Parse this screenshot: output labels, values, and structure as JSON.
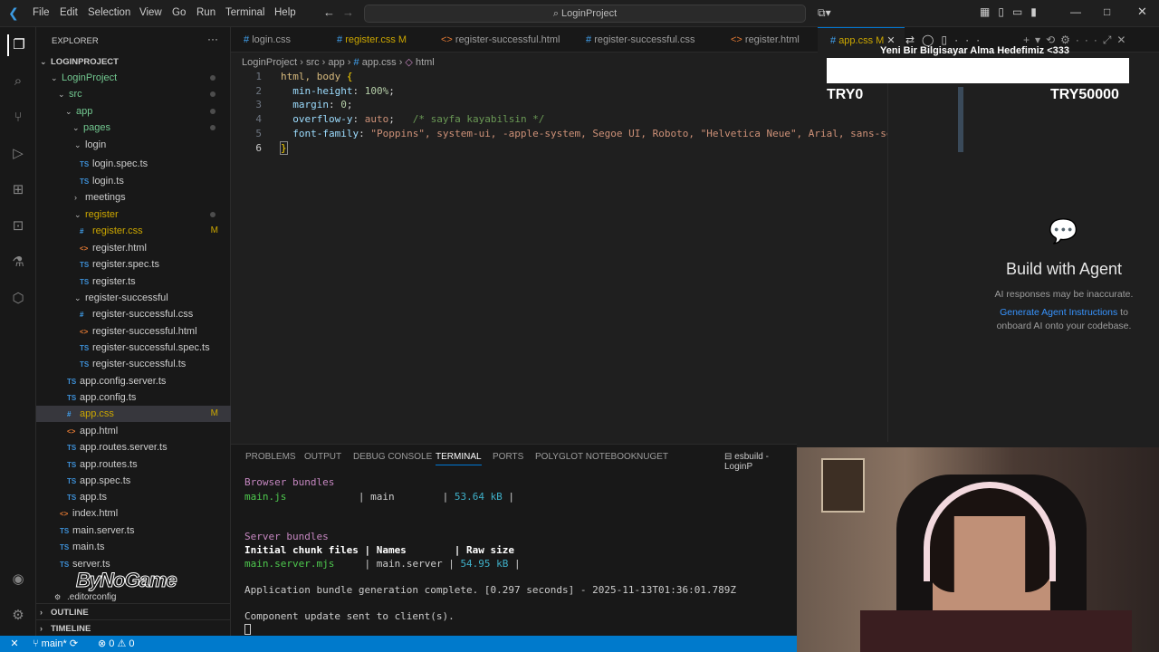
{
  "menu": [
    "File",
    "Edit",
    "Selection",
    "View",
    "Go",
    "Run",
    "Terminal",
    "Help"
  ],
  "command_center": "LoginProject",
  "sidebar": {
    "header": "EXPLORER",
    "root": "LOGINPROJECT",
    "tree": [
      {
        "label": "LoginProject",
        "type": "folder"
      },
      {
        "label": "src",
        "type": "folder"
      },
      {
        "label": "app",
        "type": "folder"
      },
      {
        "label": "pages",
        "type": "folder"
      },
      {
        "label": "login",
        "type": "folder"
      },
      {
        "label": "login.spec.ts",
        "type": "ts"
      },
      {
        "label": "login.ts",
        "type": "ts"
      },
      {
        "label": "meetings",
        "type": "folder"
      },
      {
        "label": "register",
        "type": "folder"
      },
      {
        "label": "register.css",
        "type": "css",
        "mark": "M"
      },
      {
        "label": "register.html",
        "type": "html"
      },
      {
        "label": "register.spec.ts",
        "type": "ts"
      },
      {
        "label": "register.ts",
        "type": "ts"
      },
      {
        "label": "register-successful",
        "type": "folder"
      },
      {
        "label": "register-successful.css",
        "type": "css"
      },
      {
        "label": "register-successful.html",
        "type": "html"
      },
      {
        "label": "register-successful.spec.ts",
        "type": "ts"
      },
      {
        "label": "register-successful.ts",
        "type": "ts"
      },
      {
        "label": "app.config.server.ts",
        "type": "ts"
      },
      {
        "label": "app.config.ts",
        "type": "ts"
      },
      {
        "label": "app.css",
        "type": "css",
        "mark": "M"
      },
      {
        "label": "app.html",
        "type": "html"
      },
      {
        "label": "app.routes.server.ts",
        "type": "ts"
      },
      {
        "label": "app.routes.ts",
        "type": "ts"
      },
      {
        "label": "app.spec.ts",
        "type": "ts"
      },
      {
        "label": "app.ts",
        "type": "ts"
      },
      {
        "label": "index.html",
        "type": "html"
      },
      {
        "label": "main.server.ts",
        "type": "ts"
      },
      {
        "label": "main.ts",
        "type": "ts"
      },
      {
        "label": "server.ts",
        "type": "ts"
      },
      {
        "label": ".editorconfig",
        "type": "file"
      }
    ],
    "outline": "OUTLINE",
    "timeline": "TIMELINE"
  },
  "tabs": [
    {
      "label": "login.css",
      "type": "css"
    },
    {
      "label": "register.css M",
      "type": "css"
    },
    {
      "label": "register-successful.html",
      "type": "html"
    },
    {
      "label": "register-successful.css",
      "type": "css"
    },
    {
      "label": "register.html",
      "type": "html"
    },
    {
      "label": "app.css M",
      "type": "css",
      "active": true
    }
  ],
  "breadcrumb": {
    "a": "LoginProject",
    "b": "src",
    "c": "app",
    "d": "app.css",
    "e": "html"
  },
  "code": {
    "l1": {
      "sel": "html, body",
      "brace": " {"
    },
    "l2": {
      "prop": "min-height",
      "val": "100%"
    },
    "l3": {
      "prop": "margin",
      "val": "0"
    },
    "l4": {
      "prop": "overflow-y",
      "val": "auto",
      "comment": "/* sayfa kayabilsin */"
    },
    "l5": {
      "prop": "font-family",
      "val": "\"Poppins\", system-ui, -apple-system, Segoe UI, Roboto, \"Helvetica Neue\", Arial, sans-seri"
    },
    "l6": "}"
  },
  "overlay": {
    "title": "Yeni Bir Bilgisayar Alma Hedefimiz <333",
    "left": "TRY0",
    "right": "TRY50000"
  },
  "agent": {
    "title": "Build with Agent",
    "note": "AI responses may be inaccurate.",
    "link": "Generate Agent Instructions",
    "rest": " to",
    "rest2": "onboard AI onto your codebase."
  },
  "panel": {
    "tabs": [
      "PROBLEMS",
      "OUTPUT",
      "DEBUG CONSOLE",
      "TERMINAL",
      "PORTS",
      "POLYGLOT NOTEBOOK",
      "NUGET"
    ],
    "active": "TERMINAL",
    "task": "esbuild - LoginP"
  },
  "terminal": {
    "browser_hdr": "Browser bundles",
    "r1a": "main.js",
    "r1b": "| main",
    "r1c": "| ",
    "r1d": "53.64 kB",
    "r1e": " |",
    "server_hdr": "Server bundles",
    "cols": "Initial chunk files | Names        | Raw size",
    "r2a": "main.server.mjs",
    "r2b": "| main.server",
    "r2c": "| ",
    "r2d": "54.95 kB",
    "r2e": " |",
    "done": "Application bundle generation complete. [0.297 seconds] - 2025-11-13T01:36:01.789Z",
    "update": "Component update sent to client(s)."
  },
  "status": {
    "branch": "main*",
    "errors": "0",
    "warnings": "0"
  },
  "watermark": "ByNoGame",
  "colors": {
    "accent": "#0078d4",
    "status": "#007acc",
    "modified": "#cca700"
  }
}
